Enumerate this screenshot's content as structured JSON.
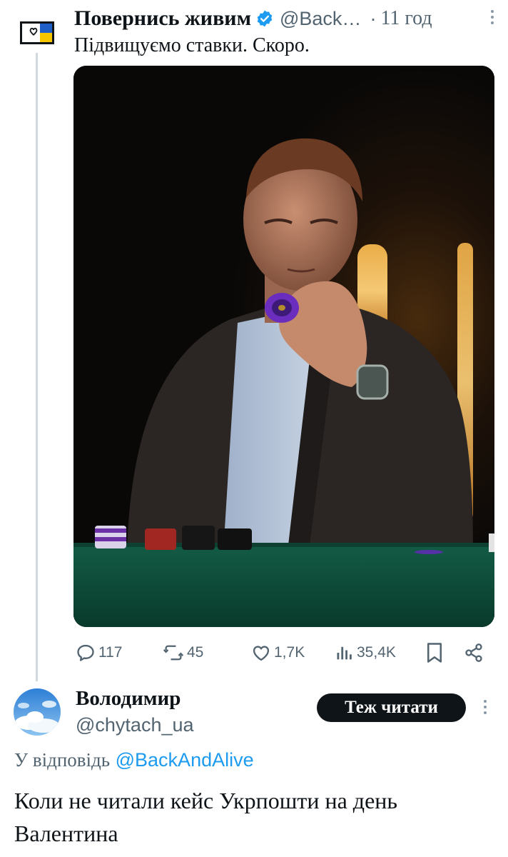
{
  "tweet": {
    "author_name": "Повернись живим",
    "handle": "@Back…",
    "separator": "·",
    "time": "11 год",
    "text": "Підвищуємо ставки. Скоро.",
    "avatar_icon": "heart-ukraine-flag-logo",
    "verified_icon": "verified-badge-icon",
    "media_description_icon": "photo",
    "actions": {
      "replies": "117",
      "reposts": "45",
      "likes": "1,7K",
      "views": "35,4K"
    }
  },
  "reply": {
    "author_name": "Володимир",
    "handle": "@chytach_ua",
    "follow_label": "Теж читати",
    "reply_to_lead": "У відповідь",
    "reply_to_handle": "@BackAndAlive",
    "text": "Коли не читали кейс Укрпошти на день Валентина"
  },
  "colors": {
    "text": "#0f1419",
    "secondary": "#536471",
    "link": "#1d9bf0",
    "verified": "#1d9bf0",
    "table_felt": "#0e4a37",
    "thread_line": "#cfd9de"
  }
}
